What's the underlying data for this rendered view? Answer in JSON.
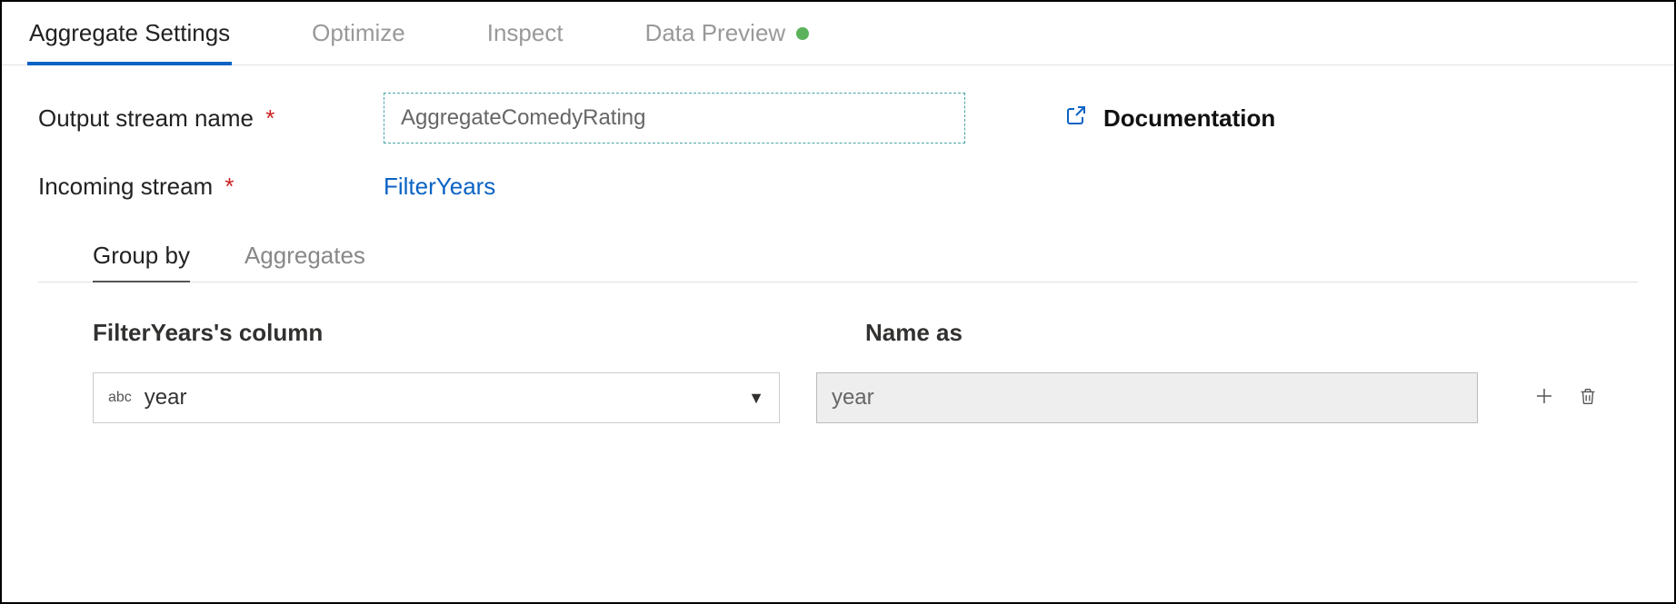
{
  "tabs": {
    "items": [
      {
        "label": "Aggregate Settings",
        "active": true
      },
      {
        "label": "Optimize"
      },
      {
        "label": "Inspect"
      },
      {
        "label": "Data Preview",
        "status": "green"
      }
    ]
  },
  "form": {
    "output_stream_label": "Output stream name",
    "output_stream_value": "AggregateComedyRating",
    "incoming_stream_label": "Incoming stream",
    "incoming_stream_value": "FilterYears",
    "documentation_label": "Documentation"
  },
  "subtabs": {
    "items": [
      {
        "label": "Group by",
        "active": true
      },
      {
        "label": "Aggregates"
      }
    ]
  },
  "columns": {
    "left_header": "FilterYears's column",
    "right_header": "Name as",
    "rows": [
      {
        "type_badge": "abc",
        "column": "year",
        "name_as": "year"
      }
    ]
  }
}
